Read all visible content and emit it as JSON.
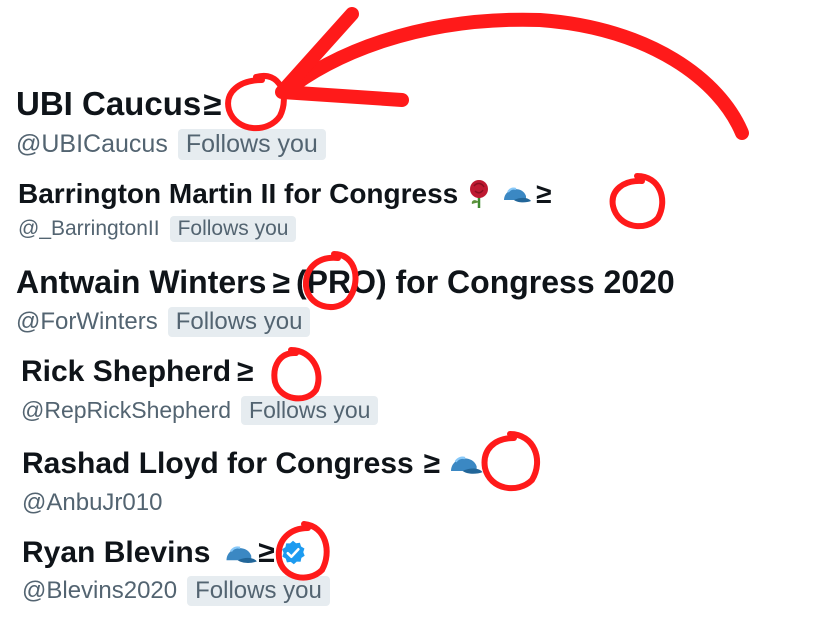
{
  "colors": {
    "annotation": "#ff1a1a",
    "badge_bg": "#e6ecf0",
    "handle_text": "#536471",
    "name_text": "#0f1419",
    "verified": "#1d9bf0",
    "cap_blue": "#3b88c3",
    "rose": "#be1931"
  },
  "profiles": [
    {
      "name": "UBI Caucus",
      "symbol": "≥",
      "handle": "@UBICaucus",
      "follows": "Follows you"
    },
    {
      "name": "Barrington Martin II for Congress",
      "symbol": "≥",
      "handle": "@_BarringtonII",
      "follows": "Follows you",
      "icons": [
        "rose-emoji",
        "blue-cap-emoji"
      ]
    },
    {
      "name": "Antwain Winters",
      "symbol": "≥",
      "name_suffix": "(PRO) for Congress 2020",
      "handle": "@ForWinters",
      "follows": "Follows you"
    },
    {
      "name": "Rick Shepherd",
      "symbol": "≥",
      "handle": "@RepRickShepherd",
      "follows": "Follows you"
    },
    {
      "name": "Rashad Lloyd for Congress",
      "symbol": "≥",
      "handle": "@AnbuJr010",
      "icons": [
        "blue-cap-emoji"
      ]
    },
    {
      "name": "Ryan Blevins",
      "symbol": "≥",
      "handle": "@Blevins2020",
      "follows": "Follows you",
      "icons": [
        "blue-cap-emoji",
        "verified-badge-icon"
      ]
    }
  ]
}
